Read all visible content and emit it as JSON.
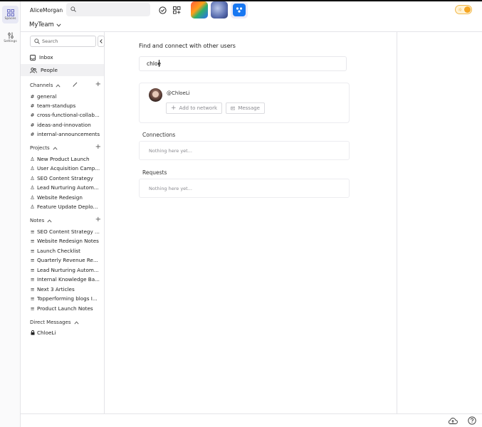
{
  "rail": {
    "spaces_label": "Spaces",
    "settings_label": "Settings"
  },
  "header": {
    "username": "AliceMorgan",
    "team": "MyTeam"
  },
  "sidebar": {
    "search_placeholder": "Search",
    "nav": [
      {
        "label": "Inbox",
        "icon": "inbox-icon"
      },
      {
        "label": "People",
        "icon": "people-icon",
        "active": true
      }
    ],
    "channels": {
      "title": "Channels",
      "items": [
        "general",
        "team-standups",
        "cross-functional-collab...",
        "ideas-and-innovation",
        "internal-announcements"
      ]
    },
    "projects": {
      "title": "Projects",
      "items": [
        "New Product Launch",
        "User Acquisition Camp...",
        "SEO Content Strategy",
        "Lead Nurturing Autom...",
        "Website Redesign",
        "Feature Update Deplo..."
      ]
    },
    "notes": {
      "title": "Notes",
      "items": [
        "SEO Content Strategy ...",
        "Website Redesign Notes",
        "Launch Checklist",
        "Quarterly Revenue Re...",
        "Lead Nurturing Autom...",
        "Internal Knowledge Ba...",
        "Next 3 Articles",
        "Topperforming blogs I...",
        "Product Launch Notes"
      ]
    },
    "dms": {
      "title": "Direct Messages",
      "items": [
        "ChloeLi"
      ]
    }
  },
  "main": {
    "title": "Find and connect with other users",
    "search_value": "chloe",
    "result": {
      "handle": "@ChloeLi",
      "add_label": "Add to network",
      "message_label": "Message"
    },
    "connections": {
      "label": "Connections",
      "empty": "Nothing here yet..."
    },
    "requests": {
      "label": "Requests",
      "empty": "Nothing here yet..."
    }
  },
  "colors": {
    "accent": "#1877f2",
    "toggle": "#f5a623",
    "border": "#e4e4e8"
  }
}
